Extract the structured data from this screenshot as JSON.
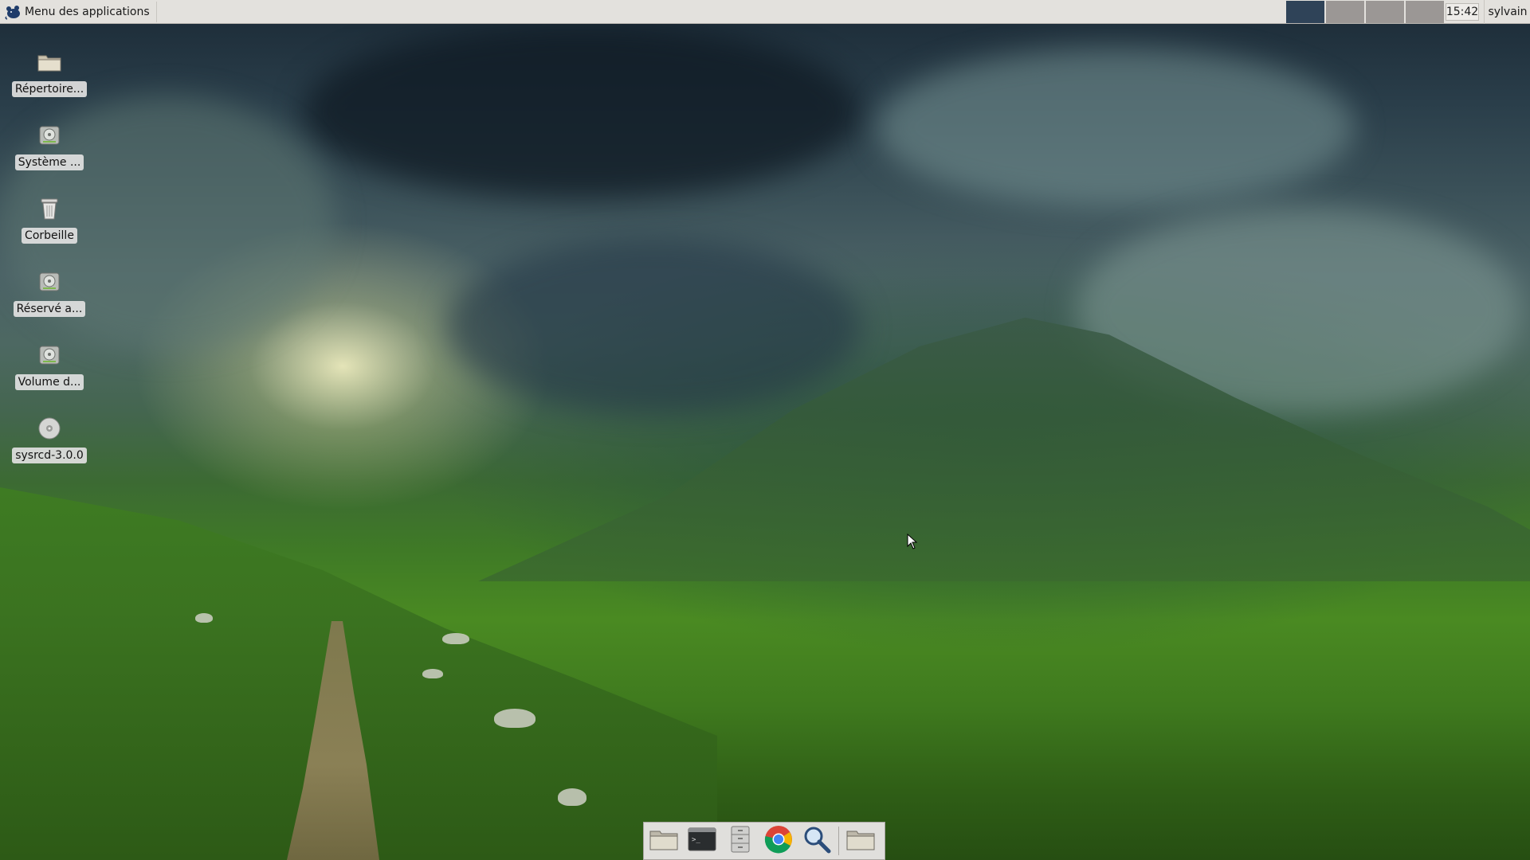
{
  "top_panel": {
    "apps_menu_label": "Menu des applications",
    "workspaces": [
      {
        "name": "workspace-1",
        "active": true
      },
      {
        "name": "workspace-2",
        "active": false
      },
      {
        "name": "workspace-3",
        "active": false
      },
      {
        "name": "workspace-4",
        "active": false
      }
    ],
    "clock": "15:42",
    "user": "sylvain"
  },
  "desktop_icons": [
    {
      "label": "Répertoire...",
      "icon": "folder-icon"
    },
    {
      "label": "Système ...",
      "icon": "drive-icon"
    },
    {
      "label": "Corbeille",
      "icon": "trash-icon"
    },
    {
      "label": "Réservé a...",
      "icon": "drive-icon"
    },
    {
      "label": "Volume d...",
      "icon": "drive-icon"
    },
    {
      "label": "sysrcd-3.0.0",
      "icon": "cdrom-icon"
    }
  ],
  "dock": {
    "launchers": [
      "folder-icon",
      "terminal-icon",
      "file-cabinet-icon",
      "chrome-icon",
      "search-icon",
      "folder-icon"
    ]
  },
  "colors": {
    "panel_bg": "#e3e1dd",
    "workspace_active": "#2f4358",
    "workspace_inactive": "#9b9795"
  }
}
